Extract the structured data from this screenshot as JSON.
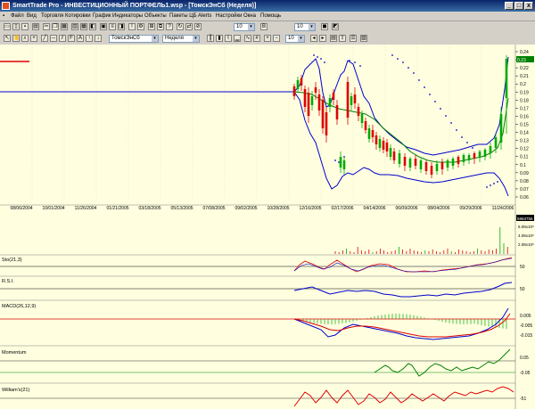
{
  "window": {
    "title": "SmartTrade Pro - ИНВЕСТИЦИОННЫЙ ПОРТФЕЛЬ1.wsp - [ТомскЭнСб (Неделя)]",
    "controls": [
      "_",
      "□",
      "x"
    ]
  },
  "menu": [
    "Файл",
    "Вид",
    "Торговля",
    "Котировки",
    "График",
    "Индикаторы",
    "Объекты",
    "Пакеты ЦБ",
    "Alerts",
    "Настройки",
    "Окна",
    "Помощь"
  ],
  "toolbar": {
    "spin1_value": "10",
    "spin2_value": "10",
    "symbol_combo": "ТомскЭнСб",
    "period_combo": "Неделя",
    "zoom_value": "10"
  },
  "price_axis": [
    "0.24",
    "0.23",
    "0.22",
    "0.21",
    "0.2",
    "0.19",
    "0.18",
    "0.17",
    "0.16",
    "0.15",
    "0.14",
    "0.13",
    "0.12",
    "0.11",
    "0.1",
    "0.09",
    "0.08",
    "0.07",
    "0.06"
  ],
  "price_current": "0.23",
  "date_axis": [
    "08/06/2004",
    "10/01/2004",
    "11/26/2004",
    "01/21/2005",
    "03/18/2005",
    "05/13/2005",
    "07/08/2005",
    "09/02/2005",
    "10/28/2005",
    "12/16/2005",
    "02/17/2006",
    "04/14/2006",
    "06/09/2006",
    "08/04/2006",
    "09/29/2006",
    "11/24/2006"
  ],
  "volume_axis": [
    "6.08x10⁶",
    "4.08x10⁶",
    "2.08x10⁶"
  ],
  "volume_current": "5963756",
  "panes": {
    "stochastic": {
      "label": "Sto(21,3)",
      "axis": [
        "50"
      ]
    },
    "rsi": {
      "label": "R.S.I.",
      "axis": [
        "50"
      ]
    },
    "macd": {
      "label": "MACD(26,12,9)",
      "axis": [
        "0.005",
        "-0.005",
        "-0.015"
      ]
    },
    "momentum": {
      "label": "Momentum",
      "axis": [
        "0.05",
        "-0.05"
      ]
    },
    "williams": {
      "label": "William's(21)",
      "axis": [
        "-51"
      ]
    }
  },
  "colors": {
    "chart_bg": "#ffffe0",
    "bollinger": "#0000cc",
    "ma": "#008000",
    "sar": "#0000cc",
    "up_candle": "#00aa00",
    "down_candle": "#dd0000"
  }
}
